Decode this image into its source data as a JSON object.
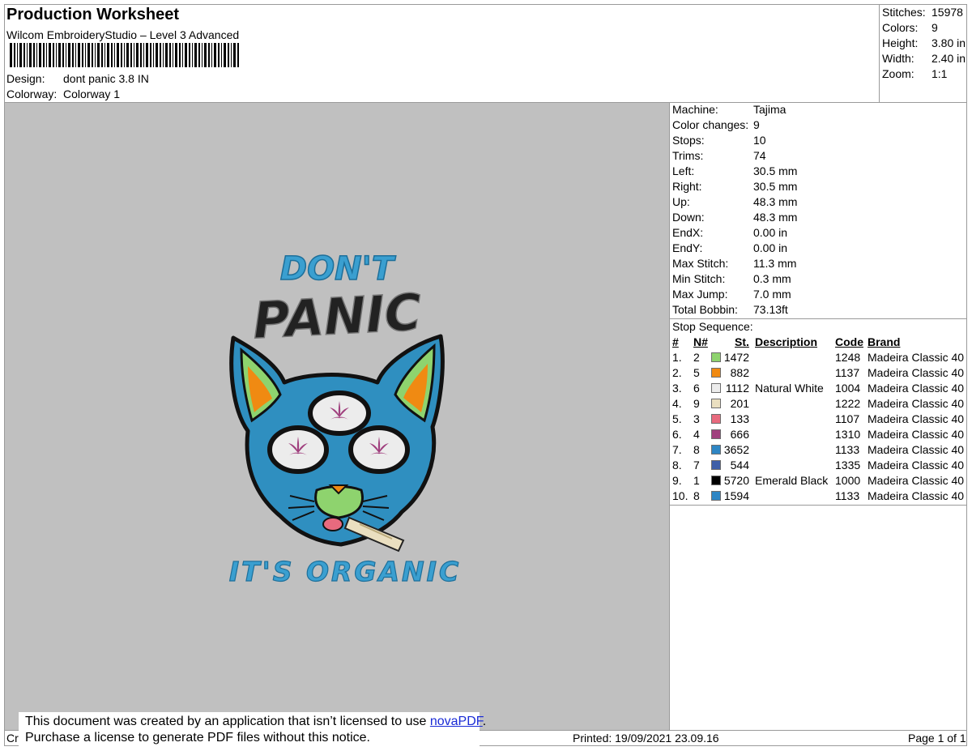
{
  "header": {
    "title": "Production Worksheet",
    "software": "Wilcom EmbroideryStudio – Level 3 Advanced",
    "design_label": "Design:",
    "design_value": "dont panic 3.8 IN",
    "colorway_label": "Colorway:",
    "colorway_value": "Colorway 1"
  },
  "summary": [
    {
      "label": "Stitches:",
      "value": "15978"
    },
    {
      "label": "Colors:",
      "value": "9"
    },
    {
      "label": "Height:",
      "value": "3.80 in"
    },
    {
      "label": "Width:",
      "value": "2.40 in"
    },
    {
      "label": "Zoom:",
      "value": "1:1"
    }
  ],
  "machine_info": [
    {
      "label": "Machine:",
      "value": "Tajima"
    },
    {
      "label": "Color changes:",
      "value": "9"
    },
    {
      "label": "Stops:",
      "value": "10"
    },
    {
      "label": "Trims:",
      "value": "74"
    },
    {
      "label": "Left:",
      "value": "30.5 mm"
    },
    {
      "label": "Right:",
      "value": "30.5 mm"
    },
    {
      "label": "Up:",
      "value": "48.3 mm"
    },
    {
      "label": "Down:",
      "value": "48.3 mm"
    },
    {
      "label": "EndX:",
      "value": "0.00 in"
    },
    {
      "label": "EndY:",
      "value": "0.00 in"
    },
    {
      "label": "Max Stitch:",
      "value": "11.3 mm"
    },
    {
      "label": "Min Stitch:",
      "value": "0.3 mm"
    },
    {
      "label": "Max Jump:",
      "value": "7.0 mm"
    },
    {
      "label": "Total Bobbin:",
      "value": "73.13ft"
    }
  ],
  "stop_sequence": {
    "label": "Stop Sequence:",
    "headers": {
      "num": "#",
      "n": "N#",
      "st": "St.",
      "desc": "Description",
      "code": "Code",
      "brand": "Brand"
    },
    "rows": [
      {
        "num": "1.",
        "n": "2",
        "color": "#8ed36e",
        "st": "1472",
        "desc": "",
        "code": "1248",
        "brand": "Madeira Classic 40"
      },
      {
        "num": "2.",
        "n": "5",
        "color": "#f08a12",
        "st": "882",
        "desc": "",
        "code": "1137",
        "brand": "Madeira Classic 40"
      },
      {
        "num": "3.",
        "n": "6",
        "color": "#ececec",
        "st": "1112",
        "desc": "Natural White",
        "code": "1004",
        "brand": "Madeira Classic 40"
      },
      {
        "num": "4.",
        "n": "9",
        "color": "#eadfc0",
        "st": "201",
        "desc": "",
        "code": "1222",
        "brand": "Madeira Classic 40"
      },
      {
        "num": "5.",
        "n": "3",
        "color": "#e86a7e",
        "st": "133",
        "desc": "",
        "code": "1107",
        "brand": "Madeira Classic 40"
      },
      {
        "num": "6.",
        "n": "4",
        "color": "#a0407e",
        "st": "666",
        "desc": "",
        "code": "1310",
        "brand": "Madeira Classic 40"
      },
      {
        "num": "7.",
        "n": "8",
        "color": "#2e86c4",
        "st": "3652",
        "desc": "",
        "code": "1133",
        "brand": "Madeira Classic 40"
      },
      {
        "num": "8.",
        "n": "7",
        "color": "#3e5fa8",
        "st": "544",
        "desc": "",
        "code": "1335",
        "brand": "Madeira Classic 40"
      },
      {
        "num": "9.",
        "n": "1",
        "color": "#000000",
        "st": "5720",
        "desc": "Emerald Black",
        "code": "1000",
        "brand": "Madeira Classic 40"
      },
      {
        "num": "10.",
        "n": "8",
        "color": "#2e86c4",
        "st": "1594",
        "desc": "",
        "code": "1133",
        "brand": "Madeira Classic 40"
      }
    ]
  },
  "design_text": {
    "line1": "DON'T",
    "line2": "PANIC",
    "line3": "IT'S ORGANIC"
  },
  "footer": {
    "left_fragment": "Cr",
    "printed": "Printed: 19/09/2021 23.09.16",
    "page": "Page 1 of 1"
  },
  "notice": {
    "line1_prefix": "This document was created by an application that isn’t licensed to use ",
    "link": "novaPDF",
    "line1_suffix": ".",
    "line2": "Purchase a license to generate PDF files without this notice."
  },
  "colors": {
    "preview_bg": "#c0c0c0",
    "thread_blue": "#3a9fd0",
    "thread_black": "#111111"
  }
}
